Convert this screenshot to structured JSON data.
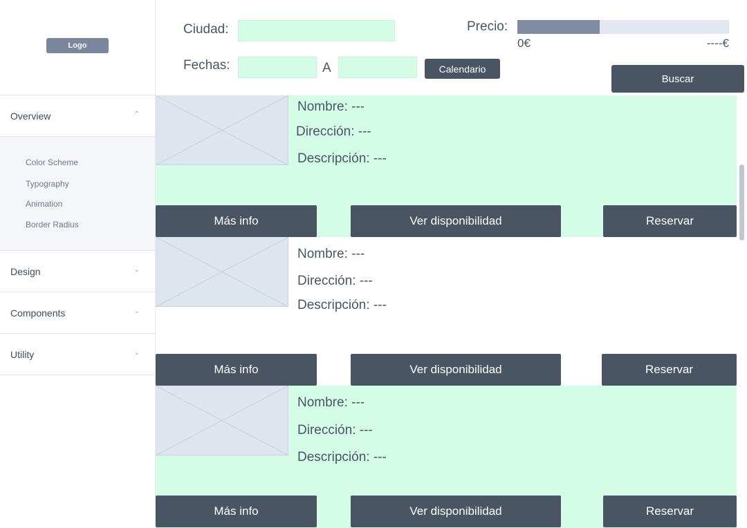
{
  "sidebar": {
    "logo": "Logo",
    "sections": [
      {
        "label": "Overview",
        "chevron": "chevron-up-icon"
      },
      {
        "label": "Design",
        "chevron": "chevron-down-icon"
      },
      {
        "label": "Components",
        "chevron": "chevron-down-icon"
      },
      {
        "label": "Utility",
        "chevron": "chevron-down-icon"
      }
    ],
    "overview_items": [
      "Color Scheme",
      "Typography",
      "Animation",
      "Border Radius"
    ]
  },
  "search": {
    "city_label": "Ciudad:",
    "city_value": "",
    "dates_label": "Fechas:",
    "date_from": "",
    "date_separator": "A",
    "date_to": "",
    "calendar_button": "Calendario",
    "price_label": "Precio:",
    "price_min": "0€",
    "price_max": "----€",
    "price_level": 0.39,
    "search_button": "Buscar"
  },
  "results": [
    {
      "name": "Nombre: ---",
      "address": "Dirección: ---",
      "description": "Descripción: ---",
      "more_info": "Más info",
      "availability": "Ver disponibilidad",
      "book": "Reservar"
    },
    {
      "name": "Nombre: ---",
      "address": "Dirección: ---",
      "description": "Descripción: ---",
      "more_info": "Más info",
      "availability": "Ver disponibilidad",
      "book": "Reservar"
    },
    {
      "name": "Nombre: ---",
      "address": "Dirección: ---",
      "description": "Descripción: ---",
      "more_info": "Más info",
      "availability": "Ver disponibilidad",
      "book": "Reservar"
    }
  ],
  "colors": {
    "accent_dark": "#4a5563",
    "field_bg": "#d4fce6",
    "price_fill": "#7f8ba1"
  }
}
